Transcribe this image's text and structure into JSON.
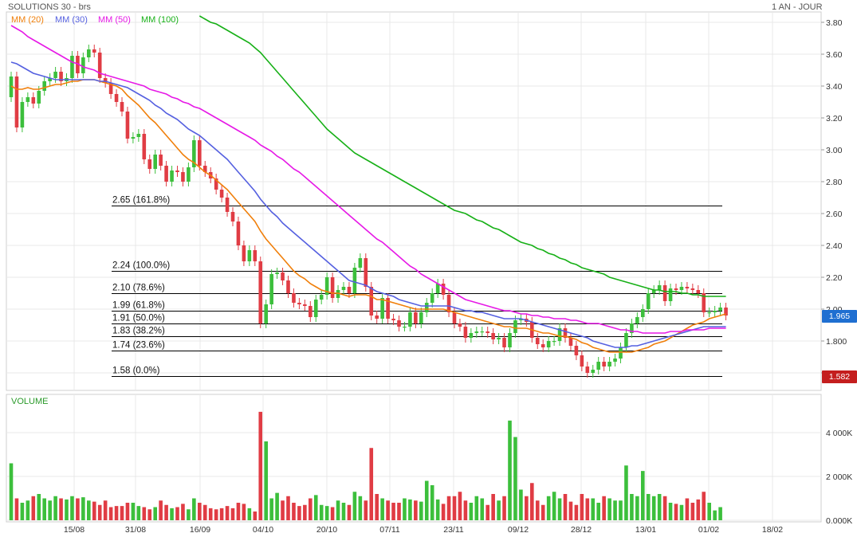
{
  "header": {
    "title": "SOLUTIONS 30 - brs",
    "period": "1 AN - JOUR"
  },
  "indicators": [
    {
      "label": "MM (20)",
      "color": "#f07f0a"
    },
    {
      "label": "MM (30)",
      "color": "#5560e0"
    },
    {
      "label": "MM (50)",
      "color": "#e619e6"
    },
    {
      "label": "MM (100)",
      "color": "#17b017"
    }
  ],
  "colors": {
    "up": "#3cbf3c",
    "down": "#e03c44",
    "fib": "#000000",
    "grid": "#e8e8e8"
  },
  "badges": {
    "last_price": "1.965",
    "last_price_color": "#1f6fd1",
    "low_marker": "1.582",
    "low_marker_color": "#c41e1e"
  },
  "volume_panel": {
    "label": "VOLUME",
    "ticks": [
      "4 000K",
      "2 000K",
      "0.000K"
    ]
  },
  "chart_data": {
    "type": "candlestick",
    "title": "SOLUTIONS 30 - brs",
    "price_axis": {
      "ticks": [
        "3.80",
        "3.60",
        "3.40",
        "3.20",
        "3.00",
        "2.80",
        "2.60",
        "2.40",
        "2.20",
        "2.00",
        "1.800",
        "1.600"
      ],
      "range": [
        1.54,
        3.86
      ]
    },
    "date_ticks": [
      "15/08",
      "31/08",
      "16/09",
      "04/10",
      "20/10",
      "07/11",
      "23/11",
      "09/12",
      "28/12",
      "13/01",
      "01/02",
      "18/02"
    ],
    "fibonacci": [
      {
        "price": 2.65,
        "label": "2.65  (161.8%)"
      },
      {
        "price": 2.24,
        "label": "2.24  (100.0%)"
      },
      {
        "price": 2.1,
        "label": "2.10  (78.6%)"
      },
      {
        "price": 1.99,
        "label": "1.99  (61.8%)"
      },
      {
        "price": 1.91,
        "label": "1.91  (50.0%)"
      },
      {
        "price": 1.83,
        "label": "1.83  (38.2%)"
      },
      {
        "price": 1.74,
        "label": "1.74  (23.6%)"
      },
      {
        "price": 1.58,
        "label": "1.58  (0.0%)"
      }
    ],
    "close": [
      3.46,
      3.14,
      3.3,
      3.33,
      3.29,
      3.37,
      3.43,
      3.45,
      3.49,
      3.43,
      3.45,
      3.59,
      3.48,
      3.58,
      3.63,
      3.61,
      3.45,
      3.42,
      3.35,
      3.3,
      3.24,
      3.07,
      3.08,
      3.1,
      2.94,
      2.88,
      2.97,
      2.9,
      2.8,
      2.87,
      2.86,
      2.8,
      2.89,
      3.06,
      2.9,
      2.86,
      2.82,
      2.75,
      2.7,
      2.61,
      2.55,
      2.4,
      2.3,
      2.37,
      2.3,
      1.91,
      2.03,
      2.22,
      2.23,
      2.18,
      2.1,
      2.04,
      2.03,
      2.02,
      1.95,
      2.06,
      2.09,
      2.2,
      2.07,
      2.12,
      2.14,
      2.1,
      2.26,
      2.32,
      2.14,
      1.96,
      1.94,
      2.07,
      1.94,
      1.93,
      1.89,
      1.89,
      1.98,
      1.91,
      1.98,
      2.04,
      2.1,
      2.16,
      2.09,
      1.98,
      1.91,
      1.89,
      1.82,
      1.85,
      1.86,
      1.86,
      1.85,
      1.81,
      1.82,
      1.76,
      1.85,
      1.93,
      1.94,
      1.92,
      1.82,
      1.78,
      1.76,
      1.8,
      1.8,
      1.88,
      1.82,
      1.77,
      1.71,
      1.64,
      1.6,
      1.62,
      1.67,
      1.64,
      1.67,
      1.69,
      1.76,
      1.85,
      1.91,
      1.95,
      2.0,
      2.1,
      2.12,
      2.15,
      2.05,
      2.13,
      2.12,
      2.14,
      2.13,
      2.12,
      2.1,
      1.98,
      1.98,
      1.99,
      2.01,
      1.96
    ],
    "volume_k": [
      2600,
      1000,
      800,
      900,
      1100,
      1200,
      1000,
      900,
      1100,
      1000,
      950,
      1100,
      1000,
      1050,
      900,
      850,
      700,
      900,
      600,
      650,
      650,
      800,
      800,
      650,
      600,
      500,
      600,
      900,
      700,
      550,
      600,
      750,
      500,
      1000,
      800,
      700,
      550,
      500,
      550,
      650,
      550,
      800,
      750,
      550,
      400,
      4950,
      3600,
      1000,
      1250,
      900,
      1100,
      800,
      650,
      700,
      1000,
      1150,
      700,
      650,
      600,
      900,
      800,
      700,
      1300,
      1100,
      900,
      3300,
      1200,
      1000,
      900,
      800,
      800,
      1000,
      950,
      900,
      850,
      1800,
      1600,
      950,
      750,
      1100,
      1100,
      1300,
      900,
      800,
      1100,
      1000,
      700,
      1200,
      900,
      1100,
      4550,
      3800,
      1400,
      1100,
      1700,
      900,
      700,
      1100,
      1300,
      1000,
      1200,
      850,
      700,
      1200,
      1000,
      1000,
      800,
      1100,
      1000,
      900,
      900,
      2500,
      1200,
      1100,
      2250,
      1200,
      1100,
      1200,
      1100,
      800,
      750,
      700,
      1000,
      800,
      950,
      1300,
      800,
      450,
      600
    ],
    "ma_20": [
      3.4,
      3.38,
      3.38,
      3.39,
      3.38,
      3.38,
      3.39,
      3.4,
      3.41,
      3.41,
      3.42,
      3.43,
      3.43,
      3.44,
      3.44,
      3.44,
      3.43,
      3.42,
      3.41,
      3.4,
      3.38,
      3.34,
      3.31,
      3.28,
      3.24,
      3.2,
      3.17,
      3.13,
      3.09,
      3.05,
      3.01,
      2.97,
      2.94,
      2.92,
      2.89,
      2.86,
      2.84,
      2.81,
      2.78,
      2.75,
      2.71,
      2.67,
      2.63,
      2.59,
      2.55,
      2.49,
      2.44,
      2.4,
      2.36,
      2.32,
      2.28,
      2.24,
      2.21,
      2.19,
      2.16,
      2.14,
      2.12,
      2.11,
      2.1,
      2.1,
      2.09,
      2.08,
      2.09,
      2.09,
      2.09,
      2.08,
      2.06,
      2.06,
      2.05,
      2.04,
      2.03,
      2.02,
      2.01,
      2.0,
      2.0,
      2.0,
      2.0,
      2.0,
      2.0,
      1.99,
      1.98,
      1.97,
      1.96,
      1.95,
      1.94,
      1.93,
      1.92,
      1.91,
      1.9,
      1.89,
      1.89,
      1.88,
      1.88,
      1.88,
      1.87,
      1.86,
      1.85,
      1.85,
      1.84,
      1.83,
      1.83,
      1.82,
      1.81,
      1.79,
      1.78,
      1.76,
      1.75,
      1.74,
      1.73,
      1.73,
      1.73,
      1.73,
      1.73,
      1.74,
      1.75,
      1.76,
      1.78,
      1.79,
      1.8,
      1.82,
      1.84,
      1.86,
      1.88,
      1.9,
      1.91,
      1.92,
      1.94,
      1.95,
      1.96,
      1.97
    ],
    "ma_30": [
      3.55,
      3.54,
      3.52,
      3.5,
      3.48,
      3.47,
      3.46,
      3.45,
      3.44,
      3.44,
      3.44,
      3.44,
      3.44,
      3.44,
      3.44,
      3.44,
      3.43,
      3.43,
      3.42,
      3.41,
      3.4,
      3.39,
      3.37,
      3.35,
      3.33,
      3.31,
      3.28,
      3.26,
      3.23,
      3.21,
      3.19,
      3.16,
      3.13,
      3.11,
      3.09,
      3.06,
      3.03,
      3.0,
      2.97,
      2.94,
      2.9,
      2.86,
      2.82,
      2.78,
      2.74,
      2.69,
      2.65,
      2.61,
      2.58,
      2.54,
      2.51,
      2.48,
      2.45,
      2.42,
      2.39,
      2.36,
      2.33,
      2.3,
      2.27,
      2.24,
      2.21,
      2.18,
      2.17,
      2.16,
      2.15,
      2.13,
      2.11,
      2.1,
      2.09,
      2.08,
      2.06,
      2.05,
      2.04,
      2.03,
      2.02,
      2.02,
      2.02,
      2.02,
      2.02,
      2.02,
      2.01,
      2.0,
      1.99,
      1.99,
      1.98,
      1.98,
      1.97,
      1.96,
      1.95,
      1.94,
      1.94,
      1.94,
      1.94,
      1.93,
      1.92,
      1.91,
      1.9,
      1.89,
      1.88,
      1.87,
      1.86,
      1.85,
      1.84,
      1.83,
      1.82,
      1.8,
      1.79,
      1.78,
      1.77,
      1.76,
      1.76,
      1.76,
      1.77,
      1.77,
      1.78,
      1.79,
      1.8,
      1.81,
      1.82,
      1.83,
      1.84,
      1.85,
      1.86,
      1.87,
      1.88,
      1.89,
      1.89,
      1.89,
      1.89,
      1.89
    ],
    "ma_50": [
      3.78,
      3.76,
      3.74,
      3.71,
      3.69,
      3.67,
      3.65,
      3.63,
      3.61,
      3.59,
      3.57,
      3.55,
      3.54,
      3.52,
      3.51,
      3.5,
      3.48,
      3.47,
      3.46,
      3.45,
      3.44,
      3.43,
      3.42,
      3.41,
      3.4,
      3.38,
      3.37,
      3.36,
      3.35,
      3.33,
      3.32,
      3.3,
      3.29,
      3.27,
      3.26,
      3.24,
      3.22,
      3.2,
      3.18,
      3.16,
      3.14,
      3.12,
      3.1,
      3.08,
      3.06,
      3.03,
      3.01,
      2.99,
      2.96,
      2.94,
      2.91,
      2.88,
      2.86,
      2.83,
      2.8,
      2.77,
      2.74,
      2.71,
      2.68,
      2.65,
      2.62,
      2.59,
      2.56,
      2.53,
      2.5,
      2.47,
      2.44,
      2.42,
      2.39,
      2.36,
      2.33,
      2.3,
      2.27,
      2.25,
      2.22,
      2.2,
      2.18,
      2.16,
      2.14,
      2.12,
      2.1,
      2.08,
      2.06,
      2.05,
      2.04,
      2.03,
      2.02,
      2.01,
      2.0,
      1.99,
      1.99,
      1.98,
      1.97,
      1.97,
      1.96,
      1.96,
      1.95,
      1.95,
      1.94,
      1.94,
      1.94,
      1.93,
      1.93,
      1.92,
      1.91,
      1.91,
      1.91,
      1.9,
      1.89,
      1.88,
      1.87,
      1.87,
      1.86,
      1.86,
      1.85,
      1.85,
      1.85,
      1.85,
      1.85,
      1.86,
      1.86,
      1.86,
      1.87,
      1.87,
      1.87,
      1.87,
      1.88,
      1.88,
      1.88,
      1.88
    ],
    "ma_100": [
      null,
      null,
      null,
      null,
      null,
      null,
      null,
      null,
      null,
      null,
      null,
      null,
      null,
      null,
      null,
      null,
      null,
      null,
      null,
      null,
      null,
      null,
      null,
      null,
      null,
      null,
      null,
      null,
      null,
      null,
      null,
      null,
      null,
      null,
      3.84,
      3.82,
      3.8,
      3.79,
      3.77,
      3.75,
      3.73,
      3.71,
      3.69,
      3.67,
      3.64,
      3.61,
      3.57,
      3.53,
      3.49,
      3.45,
      3.41,
      3.37,
      3.33,
      3.29,
      3.25,
      3.21,
      3.17,
      3.13,
      3.1,
      3.07,
      3.04,
      3.01,
      2.98,
      2.96,
      2.94,
      2.92,
      2.9,
      2.88,
      2.86,
      2.84,
      2.82,
      2.8,
      2.78,
      2.76,
      2.74,
      2.72,
      2.7,
      2.68,
      2.66,
      2.64,
      2.62,
      2.61,
      2.6,
      2.58,
      2.56,
      2.55,
      2.53,
      2.51,
      2.5,
      2.48,
      2.46,
      2.44,
      2.42,
      2.41,
      2.4,
      2.38,
      2.37,
      2.35,
      2.34,
      2.32,
      2.31,
      2.29,
      2.28,
      2.26,
      2.25,
      2.24,
      2.23,
      2.22,
      2.2,
      2.19,
      2.18,
      2.17,
      2.16,
      2.15,
      2.14,
      2.13,
      2.12,
      2.12,
      2.11,
      2.11,
      2.11,
      2.1,
      2.1,
      2.09,
      2.09,
      2.08,
      2.08,
      2.08,
      2.08,
      2.08
    ]
  }
}
